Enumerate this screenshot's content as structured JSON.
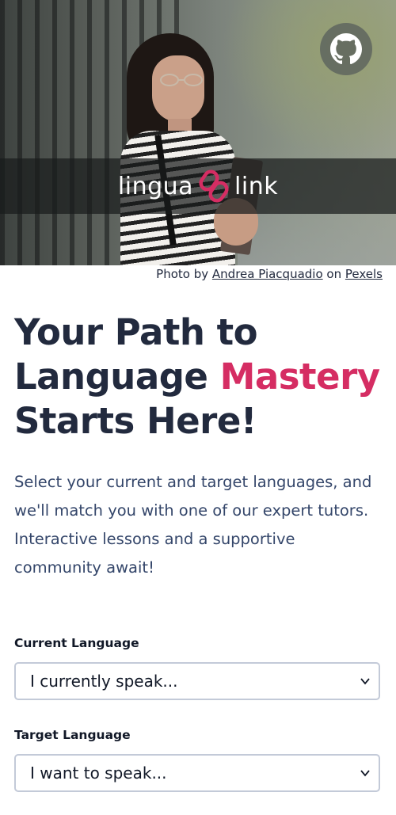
{
  "hero": {
    "brand_left": "lingua",
    "brand_right": "link",
    "brand_icon": "chain-link-icon",
    "github_icon": "github-icon",
    "colors": {
      "accent": "#d52d63",
      "band": "#191c1c"
    }
  },
  "credit": {
    "prefix": "Photo by",
    "author": "Andrea Piacquadio",
    "middle": "on",
    "source": "Pexels"
  },
  "headline": {
    "line1": "Your Path to",
    "line2_plain": "Language",
    "line2_accent": "Mastery",
    "line3": "Starts Here!"
  },
  "intro": "Select your current and target languages, and we'll match you with one of our expert tutors. Interactive lessons and a supportive community await!",
  "form": {
    "current": {
      "label": "Current Language",
      "value": "I currently speak..."
    },
    "target": {
      "label": "Target Language",
      "value": "I want to speak..."
    }
  },
  "colors": {
    "text": "#222a3e",
    "body_text": "#34466a",
    "accent": "#d52d63",
    "border": "#c3cad8"
  }
}
